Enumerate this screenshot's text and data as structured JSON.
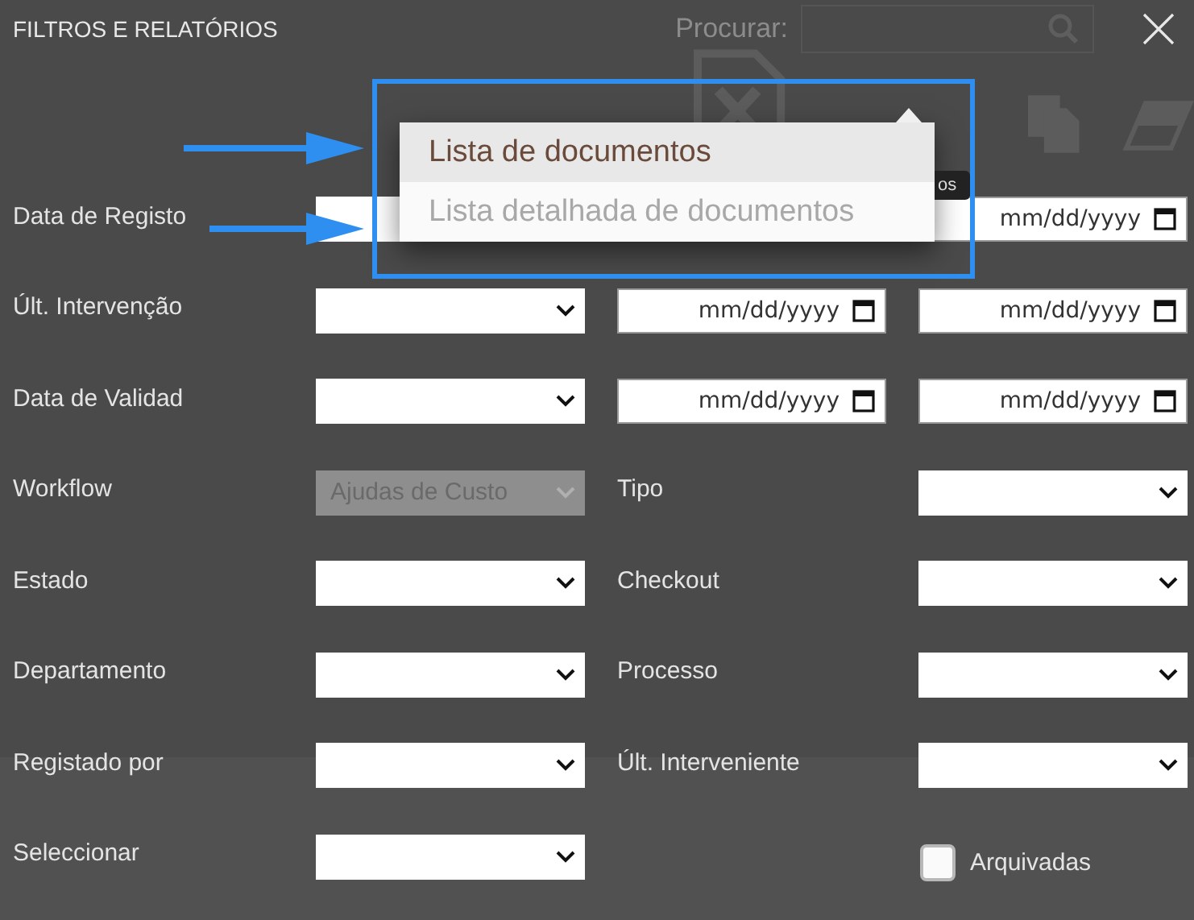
{
  "dialog": {
    "title": "FILTROS E RELATÓRIOS"
  },
  "search": {
    "label": "Procurar:"
  },
  "rows": [
    {
      "label": "Data de Registo",
      "cells": [
        {
          "kind": "select",
          "disabled": false
        },
        {
          "kind": "empty"
        },
        {
          "kind": "date",
          "placeholder": "mm/dd/yyyy"
        }
      ]
    },
    {
      "label": "Últ. Intervenção",
      "cells": [
        {
          "kind": "select",
          "disabled": false
        },
        {
          "kind": "date",
          "placeholder": "mm/dd/yyyy"
        },
        {
          "kind": "date",
          "placeholder": "mm/dd/yyyy"
        }
      ]
    },
    {
      "label": "Data de Validad",
      "cells": [
        {
          "kind": "select",
          "disabled": false
        },
        {
          "kind": "date",
          "placeholder": "mm/dd/yyyy"
        },
        {
          "kind": "date",
          "placeholder": "mm/dd/yyyy"
        }
      ]
    },
    {
      "label": "Workflow",
      "cells": [
        {
          "kind": "select",
          "disabled": true,
          "value": "Ajudas de Custo"
        },
        {
          "kind": "label",
          "text": "Tipo"
        },
        {
          "kind": "select",
          "disabled": false
        }
      ]
    },
    {
      "label": "Estado",
      "cells": [
        {
          "kind": "select",
          "disabled": false
        },
        {
          "kind": "label",
          "text": "Checkout"
        },
        {
          "kind": "select",
          "disabled": false
        }
      ]
    },
    {
      "label": "Departamento",
      "cells": [
        {
          "kind": "select",
          "disabled": false
        },
        {
          "kind": "label",
          "text": "Processo"
        },
        {
          "kind": "select",
          "disabled": false
        }
      ]
    },
    {
      "label": "Registado por",
      "cells": [
        {
          "kind": "select",
          "disabled": false
        },
        {
          "kind": "label",
          "text": "Últ. Interveniente"
        },
        {
          "kind": "select",
          "disabled": false
        }
      ]
    },
    {
      "label": "Seleccionar",
      "cells": [
        {
          "kind": "select",
          "disabled": false
        },
        {
          "kind": "empty"
        },
        {
          "kind": "checkbox",
          "label": "Arquivadas",
          "checked": false
        }
      ]
    }
  ],
  "menu": {
    "items": [
      {
        "label": "Lista de documentos",
        "selected": true
      },
      {
        "label": "Lista detalhada de documentos",
        "selected": false
      }
    ]
  },
  "tooltip": {
    "text": "os"
  }
}
